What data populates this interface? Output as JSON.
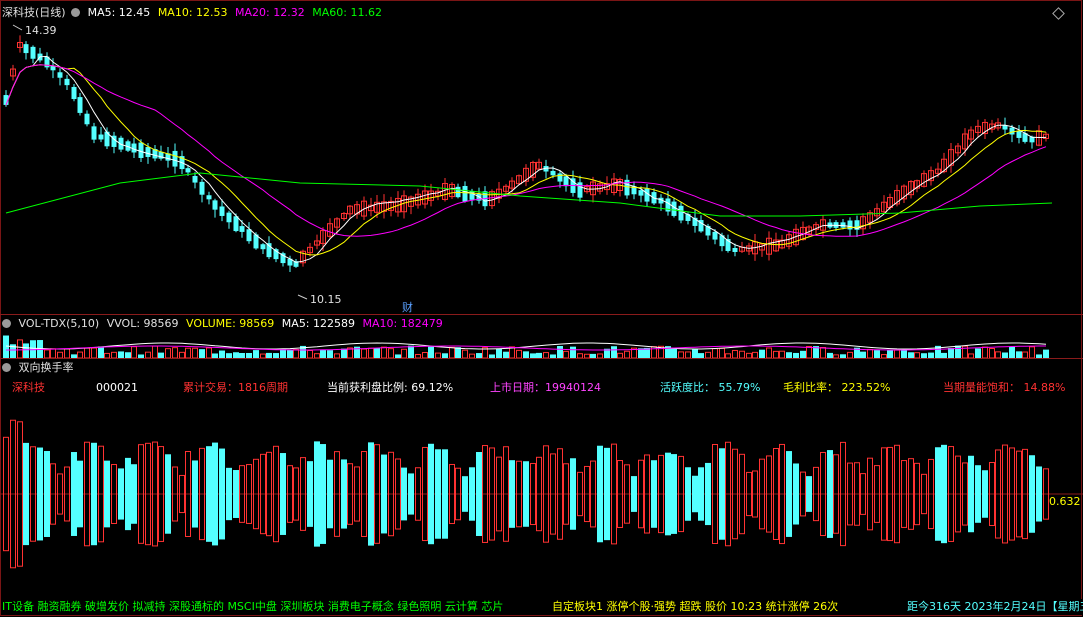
{
  "main_chart": {
    "title": "深科技(日线)",
    "ma5": "MA5: 12.45",
    "ma10": "MA10: 12.53",
    "ma20": "MA20: 12.32",
    "ma60": "MA60: 11.62",
    "high_label": "14.39",
    "low_label": "10.15",
    "marker": "财",
    "colors": {
      "ma5": "#ffffff",
      "ma10": "#ffff00",
      "ma20": "#ff00ff",
      "ma60": "#00ff00",
      "up": "#ff3232",
      "down": "#54ffff"
    }
  },
  "volume_panel": {
    "name": "VOL-TDX(5,10)",
    "vvol": "VVOL: 98569",
    "volume": "VOLUME: 98569",
    "ma5": "MA5: 122589",
    "ma10": "MA10: 182479"
  },
  "turnover_panel": {
    "title": "双向换手率",
    "value_label": "0.632"
  },
  "info": {
    "name": "深科技",
    "code": "000021",
    "cum_trade": "累计交易：1816周期",
    "profit_ratio": "当前获利盘比例: 69.12%",
    "listing_date": "上市日期：19940124",
    "activity": "活跃度比：  55.79%",
    "gross_margin": "毛利比率：  223.52%",
    "energy": "当期量能饱和：  14.88%"
  },
  "ticker": {
    "left": "IT设备 融资融券 破增发价 拟减持 深股通标的 MSCI中盘 深圳板块 消费电子概念 绿色照明 云计算 芯片",
    "middle": "自定板块1 涨停个股·强势 超跌 股价 10:23 统计涨停 26次",
    "right": "距今316天 2023年2月24日【星期五"
  }
}
